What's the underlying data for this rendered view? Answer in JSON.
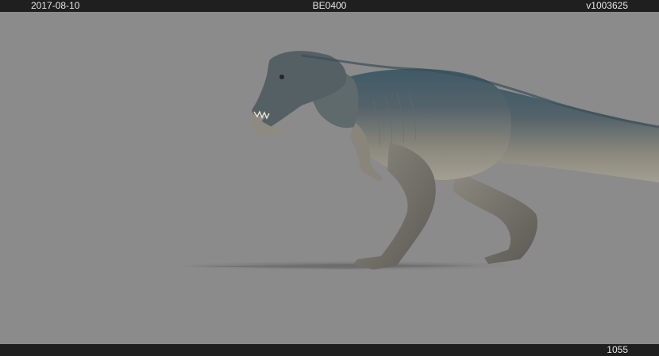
{
  "header": {
    "date": "2017-08-10",
    "shot": "BE0400",
    "version": "v1003625"
  },
  "footer": {
    "frame": "1055"
  },
  "viewport": {
    "subject": "dinosaur-render",
    "background_color": "#8b8b8b"
  }
}
